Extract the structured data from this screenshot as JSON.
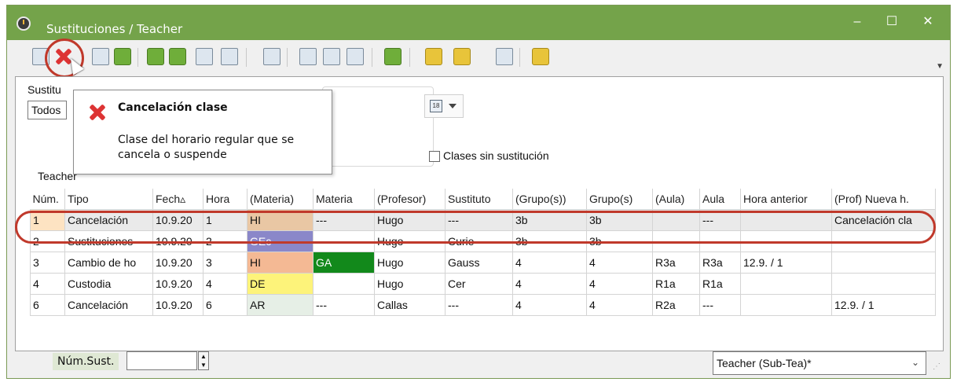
{
  "window": {
    "title": "Sustituciones / Teacher",
    "minimize": "–",
    "maximize": "☐",
    "close": "✕"
  },
  "filter": {
    "label": "Sustitu",
    "value": "Todos"
  },
  "calendar_icon_text": "18",
  "checkbox_label": "Clases sin sustitución",
  "teacher_label": "Teacher",
  "tooltip": {
    "title": "Cancelación clase",
    "body": "Clase del horario regular que se cancela o suspende"
  },
  "table": {
    "headers": [
      "Núm.",
      "Tipo",
      "Fech▵",
      "Hora",
      "(Materia)",
      "Materia",
      "(Profesor)",
      "Sustituto",
      "(Grupo(s))",
      "Grupo(s)",
      "(Aula)",
      "Aula",
      "Hora anterior",
      "(Prof) Nueva h."
    ],
    "rows": [
      [
        "1",
        "Cancelación",
        "10.9.20",
        "1",
        "HI",
        "---",
        "Hugo",
        "---",
        "3b",
        "3b",
        "",
        "---",
        "",
        "Cancelación cla"
      ],
      [
        "2",
        "Sustituciones",
        "10.9.20",
        "2",
        "GEc",
        "",
        "Hugo",
        "Curie",
        "3b",
        "3b",
        "",
        "",
        "",
        ""
      ],
      [
        "3",
        "Cambio de ho",
        "10.9.20",
        "3",
        "HI",
        "GA",
        "Hugo",
        "Gauss",
        "4",
        "4",
        "R3a",
        "R3a",
        "12.9. / 1",
        ""
      ],
      [
        "4",
        "Custodia",
        "10.9.20",
        "4",
        "DE",
        "",
        "Hugo",
        "Cer",
        "4",
        "4",
        "R1a",
        "R1a",
        "",
        ""
      ],
      [
        "6",
        "Cancelación",
        "10.9.20",
        "6",
        "AR",
        "---",
        "Callas",
        "---",
        "4",
        "4",
        "R2a",
        "---",
        "",
        "12.9. / 1"
      ]
    ]
  },
  "footer": {
    "num_sust_label": "Núm.Sust.",
    "num_sust_value": "",
    "view_value": "Teacher (Sub-Tea)*"
  },
  "colors": {
    "title_bar": "#74a34a",
    "highlight": "#c0392b"
  }
}
